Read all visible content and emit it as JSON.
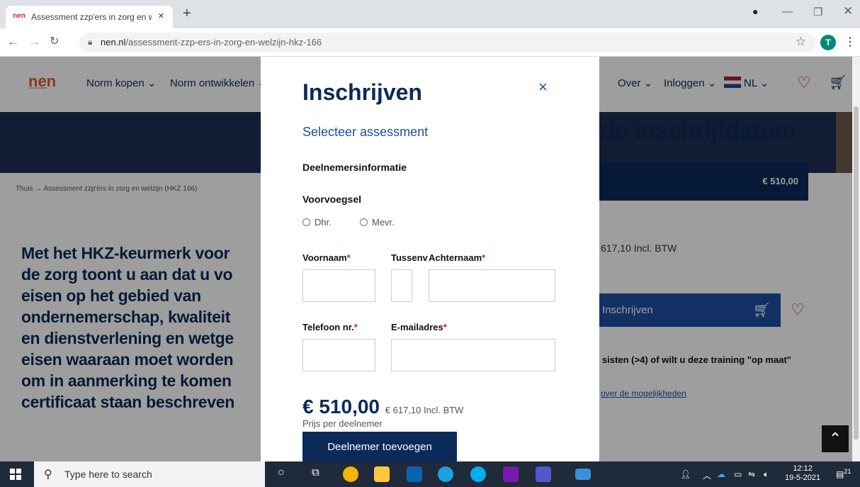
{
  "browser": {
    "tab_favicon": "nen",
    "tab_title": "Assessment zzp'ers in zorg en welzijn",
    "tab_close": "×",
    "new_tab": "+",
    "url_domain": "nen.nl",
    "url_path": "/assessment-zzp-ers-in-zorg-en-welzijn-hkz-166",
    "avatar": "T"
  },
  "site": {
    "logo": "n̲e̲n",
    "menu": [
      "Norm kopen ⌄",
      "Norm ontwikkelen ⌄",
      "Over ⌄",
      "Inloggen ⌄",
      "NL ⌄"
    ],
    "hero_title": "de inschrijfdatum",
    "breadcrumb": "Thuis → Assessment zzp'ers in zorg en welzijn (HKZ 166)",
    "price_box": "€ 510,00",
    "price_incl": "617,10 Incl. BTW",
    "inschrijven_button": "Inschrijven",
    "group_text": "sisten (>4) of wilt u deze training \"op maat\"",
    "more_link": "over de mogelijkheden",
    "body_text": "Met het HKZ-keurmerk voor\nde zorg toont u aan dat u vo\neisen op het gebied van\nondernemerschap, kwaliteit\nen dienstverlening en wetge\neisen waaraan moet worden\nom in aanmerking te komen\ncertificaat staan beschreven"
  },
  "modal": {
    "title": "Inschrijven",
    "close": "×",
    "subtitle": "Selecteer assessment",
    "section": "Deelnemersinformatie",
    "prefix_label": "Voorvoegsel",
    "prefix_options": [
      "Dhr.",
      "Mevr."
    ],
    "voornaam": "Voornaam",
    "tussenvoegsel": "Tussenv",
    "achternaam": "Achternaam",
    "telefoon": "Telefoon nr.",
    "email": "E-mailadres",
    "required_mark": "*",
    "price": "€ 510,00",
    "price_incl": "€ 617,10 Incl. BTW",
    "per_participant": "Prijs per deelnemer",
    "add_button": "Deelnemer toevoegen"
  },
  "taskbar": {
    "search_placeholder": "Type here to search",
    "time": "12:12",
    "date": "19-5-2021",
    "notifications": "21"
  }
}
